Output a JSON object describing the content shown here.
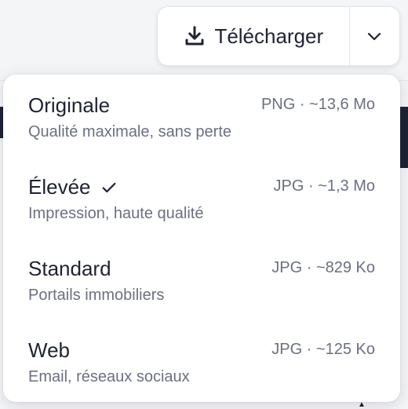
{
  "download": {
    "label": "Télécharger",
    "icon": "download-icon",
    "menu_icon": "chevron-down-icon"
  },
  "menu": {
    "items": [
      {
        "name": "Originale",
        "meta": "PNG · ~13,6 Mo",
        "desc": "Qualité maximale, sans perte",
        "selected": false
      },
      {
        "name": "Élevée",
        "meta": "JPG · ~1,3 Mo",
        "desc": "Impression, haute qualité",
        "selected": true,
        "icon": "check-icon"
      },
      {
        "name": "Standard",
        "meta": "JPG · ~829 Ko",
        "desc": "Portails immobiliers",
        "selected": false
      },
      {
        "name": "Web",
        "meta": "JPG · ~125 Ko",
        "desc": "Email, réseaux sociaux",
        "selected": false
      }
    ]
  },
  "colors": {
    "text": "#1f2333",
    "muted": "#6b7080",
    "border": "#e3e5e8",
    "dark": "#1d2235"
  }
}
